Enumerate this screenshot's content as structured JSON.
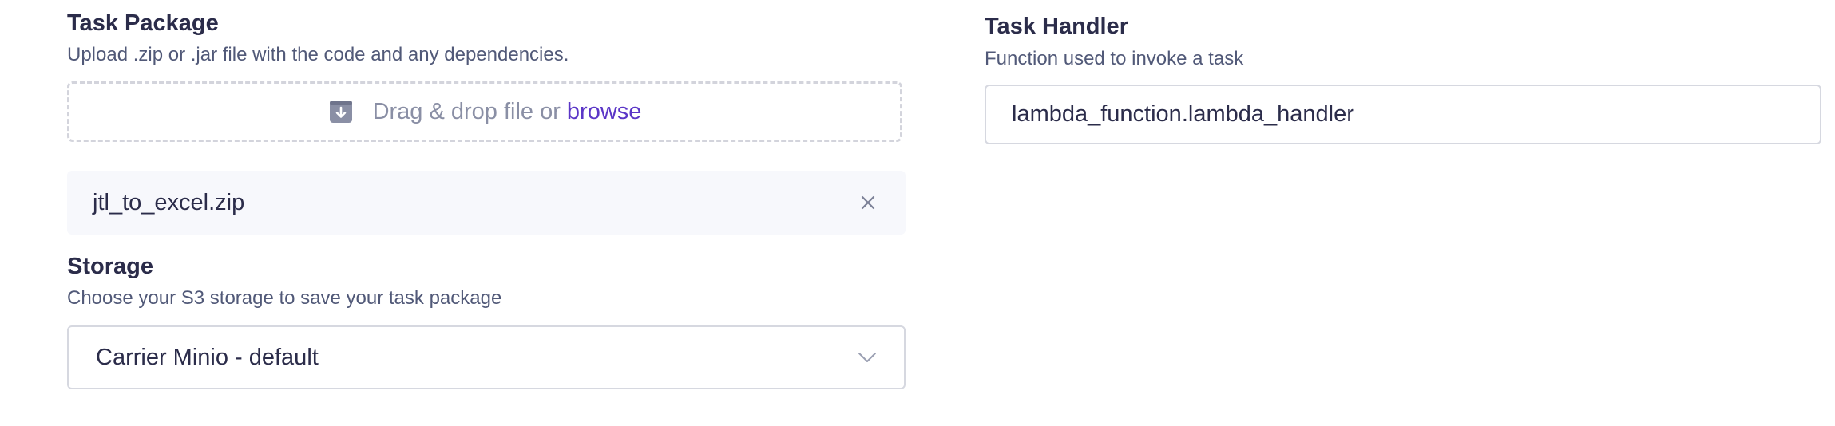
{
  "task_package": {
    "title": "Task Package",
    "description": "Upload .zip or .jar file with the code and any dependencies.",
    "dropzone_text": "Drag & drop file or",
    "browse_label": "browse",
    "dropzone_icon": "download-box-icon",
    "uploaded_file": {
      "name": "jtl_to_excel.zip",
      "remove_icon": "close-icon"
    }
  },
  "storage": {
    "title": "Storage",
    "description": "Choose your S3 storage to save your task package",
    "selected_value": "Carrier Minio - default",
    "chevron_icon": "chevron-down-icon"
  },
  "task_handler": {
    "title": "Task Handler",
    "description": "Function used to invoke a task",
    "value": "lambda_function.lambda_handler"
  },
  "colors": {
    "heading": "#2b2c4a",
    "muted_text": "#515978",
    "link": "#5b36c7",
    "border": "#d6d8e0",
    "chip_background": "#f7f8fc"
  }
}
